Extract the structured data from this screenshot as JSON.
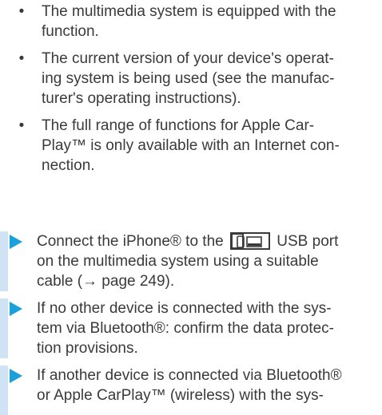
{
  "prerequisites": [
    {
      "lines": [
        "The multimedia system is equipped with the",
        "function."
      ]
    },
    {
      "lines": [
        "The current version of your device's operat-",
        "ing system is being used (see the manufac-",
        "turer's operating instructions)."
      ]
    },
    {
      "lines": [
        "The full range of functions for Apple Car-",
        "Play™ is only available with an Internet con-",
        "nection."
      ]
    }
  ],
  "steps": [
    {
      "line1_before_icon": "Connect the iPhone® to the",
      "line1_after_icon": "USB port",
      "icon": "usb-phone-icon",
      "lines": [
        "on the multimedia system using a suitable",
        "cable (→ page 249)."
      ]
    },
    {
      "lines": [
        "If no other device is connected with the sys-",
        "tem via Bluetooth®: confirm the data protec-",
        "tion provisions."
      ]
    },
    {
      "lines": [
        "If another device is connected via Bluetooth®",
        "or Apple CarPlay™ (wireless) with the sys-"
      ]
    }
  ],
  "colors": {
    "text": "#3a3a3a",
    "step_arrow": "#1aa0da",
    "step_bar": "#cfe3f4"
  }
}
